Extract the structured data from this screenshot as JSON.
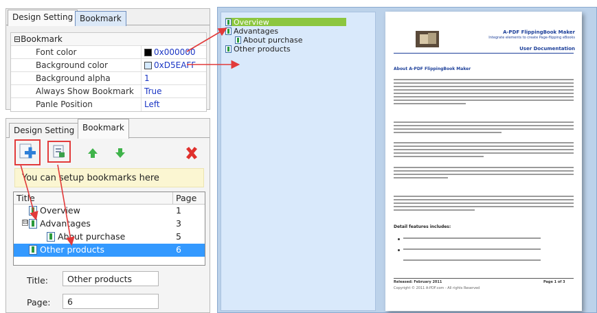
{
  "top_panel": {
    "tabs": [
      {
        "label": "Design Setting"
      },
      {
        "label": "Bookmark"
      }
    ],
    "group_label": "Bookmark",
    "group_toggle": "⊟",
    "properties": [
      {
        "key": "Font color",
        "value": "0x000000",
        "swatch": "#000000"
      },
      {
        "key": "Background color",
        "value": "0xD5EAFF",
        "swatch": "#d5eaff"
      },
      {
        "key": "Background alpha",
        "value": "1"
      },
      {
        "key": "Always Show Bookmark",
        "value": "True"
      },
      {
        "key": "Panle Position",
        "value": "Left"
      }
    ]
  },
  "bottom_panel": {
    "tabs": [
      {
        "label": "Design Setting"
      },
      {
        "label": "Bookmark"
      }
    ],
    "hint": "You can setup bookmarks here",
    "tree_headers": {
      "title": "Title",
      "page": "Page"
    },
    "tree_rows": [
      {
        "title": "Overview",
        "page": "1"
      },
      {
        "title": "Advantages",
        "page": "3"
      },
      {
        "title": "About purchase",
        "page": "5"
      },
      {
        "title": "Other products",
        "page": "6"
      }
    ],
    "selected_row": 3,
    "title_label": "Title:",
    "title_value": "Other products",
    "page_label": "Page:",
    "page_value": "6",
    "expander": "⊟"
  },
  "viewer": {
    "bookmarks": [
      {
        "title": "Overview"
      },
      {
        "title": "Advantages"
      },
      {
        "title": "About purchase"
      },
      {
        "title": "Other products"
      }
    ],
    "page": {
      "heading1": "A-PDF FlippingBook Maker",
      "heading2": "Integrate elements to create Page-flipping eBooks",
      "heading3": "User Documentation",
      "section1": "About A-PDF FlippingBook Maker",
      "section2": "Detail features includes:",
      "footer_left": "Released: February 2011",
      "footer_right": "Page 1 of 3",
      "copyright": "Copyright © 2011 A-PDF.com - All rights Reserved"
    }
  },
  "colors": {
    "arrow": "#e23a3a",
    "selection": "#3399ff",
    "viewer_selection": "#8cc63f",
    "bookmark_pane_bg": "#d9e9fb"
  }
}
